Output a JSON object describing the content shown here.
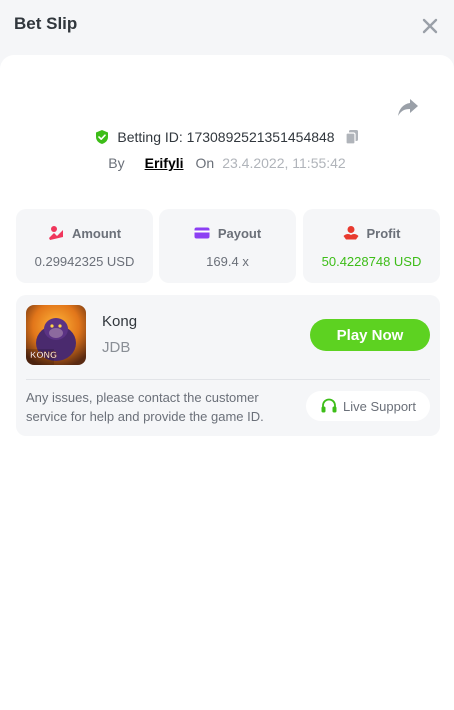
{
  "header": {
    "title": "Bet Slip",
    "close_icon": "close-icon"
  },
  "bet": {
    "share_icon": "share-icon",
    "betting_id_label": "Betting ID:",
    "betting_id": "1730892521351454848",
    "by_label": "By",
    "user": "Erifyli",
    "on_label": "On",
    "date": "23.4.2022, 11:55:42"
  },
  "stats": [
    {
      "label": "Amount",
      "value": "0.29942325 USD",
      "icon": "coins-icon"
    },
    {
      "label": "Payout",
      "value": "169.4 x",
      "icon": "card-icon"
    },
    {
      "label": "Profit",
      "value": "50.4228748 USD",
      "icon": "hand-coin-icon"
    }
  ],
  "game": {
    "name": "Kong",
    "provider": "JDB",
    "thumb_text": "KONG",
    "play_label": "Play Now",
    "notice": "Any issues, please contact the customer service for help and provide the game ID.",
    "support_label": "Live Support"
  },
  "colors": {
    "accent_green": "#5dd221",
    "profit_green": "#3dbd18",
    "amount_pink": "#f0365c",
    "payout_purple": "#8c3ff3",
    "profit_red": "#e83a2f"
  }
}
